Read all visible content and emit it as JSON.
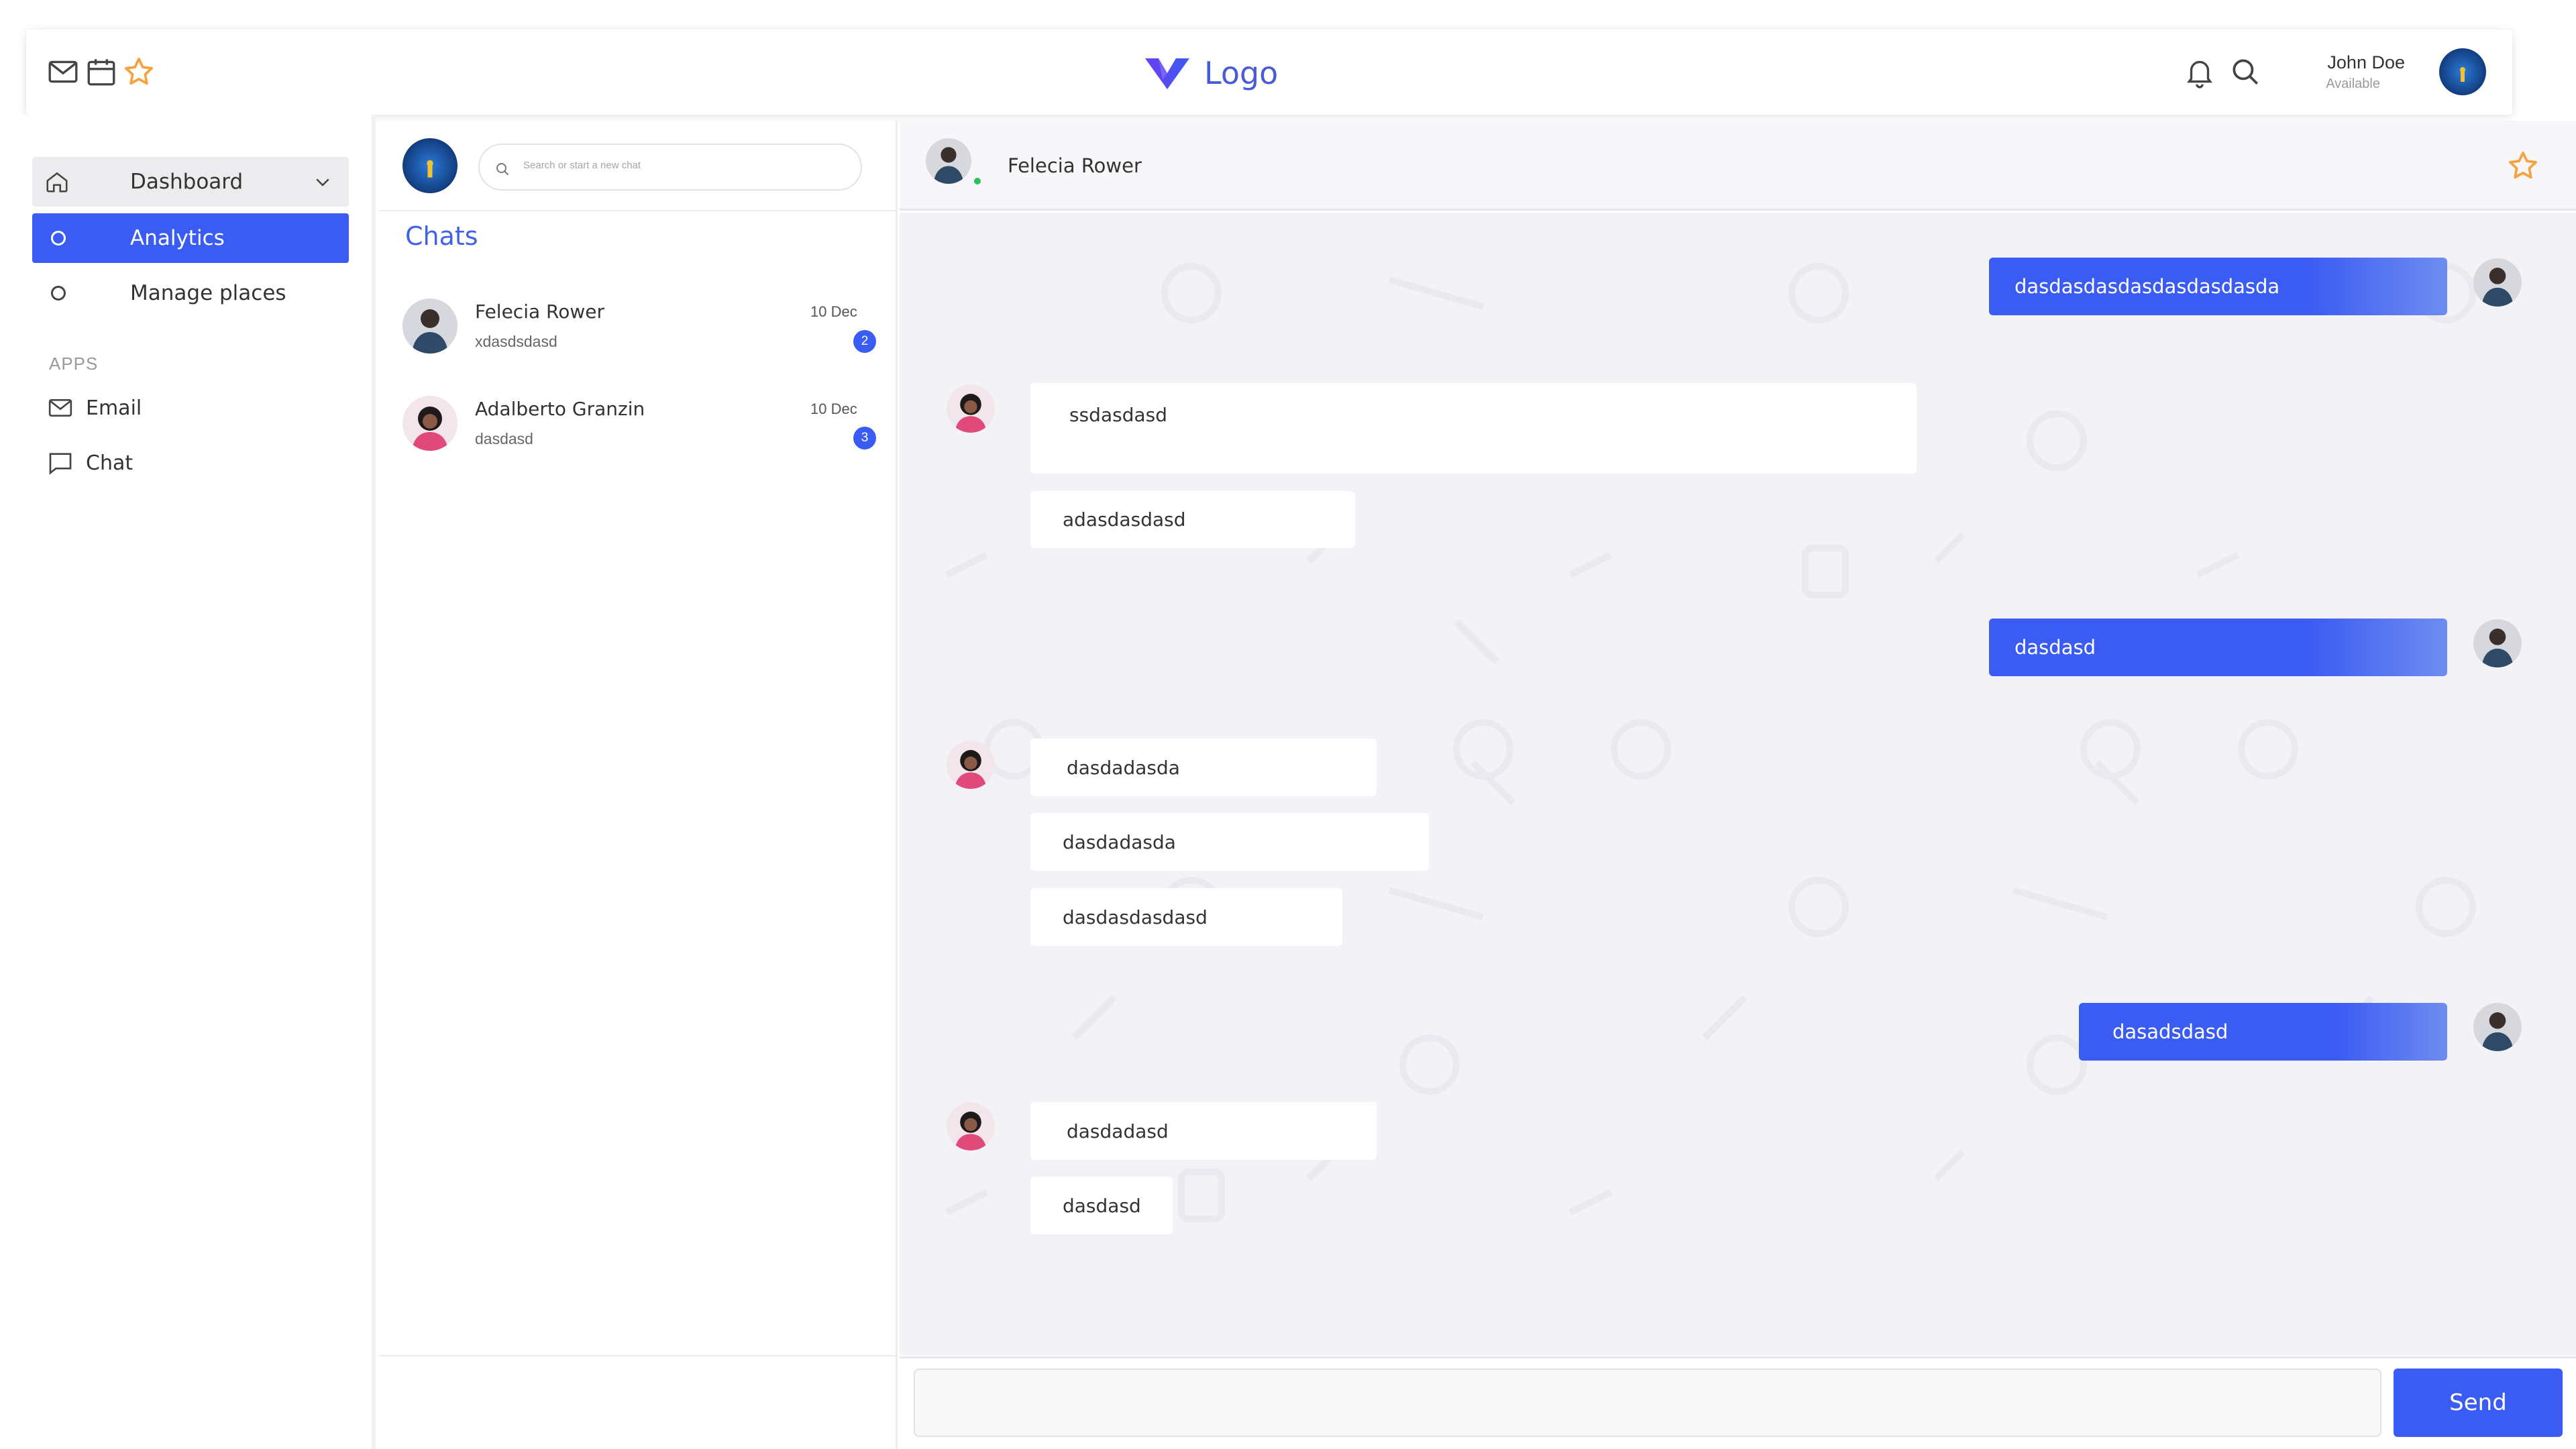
{
  "colors": {
    "accent": "#3b5cf3",
    "star": "#f5a340",
    "online": "#2fbf5a"
  },
  "topbar": {
    "icons": [
      "mail-icon",
      "calendar-icon",
      "star-icon"
    ],
    "logo_text": "Logo",
    "right_icons": [
      "bell-icon",
      "search-icon"
    ],
    "user": {
      "name": "John Doe",
      "status": "Available"
    }
  },
  "sidebar": {
    "dashboard_label": "Dashboard",
    "items": [
      {
        "label": "Analytics",
        "active": true
      },
      {
        "label": "Manage places",
        "active": false
      }
    ],
    "apps_heading": "APPS",
    "apps": [
      {
        "label": "Email",
        "icon": "mail-icon"
      },
      {
        "label": "Chat",
        "icon": "chat-bubble-icon"
      }
    ]
  },
  "chat_list": {
    "search_placeholder": "Search or start a new chat",
    "title": "Chats",
    "chats": [
      {
        "name": "Felecia Rower",
        "preview": "xdasdsdasd",
        "date": "10 Dec",
        "unread": "2"
      },
      {
        "name": "Adalberto Granzin",
        "preview": "dasdasd",
        "date": "10 Dec",
        "unread": "3"
      }
    ]
  },
  "conversation": {
    "contact_name": "Felecia Rower",
    "messages": [
      {
        "from": "me",
        "text": "dasdasdasdasdasdasdasda"
      },
      {
        "from": "them",
        "text": "ssdasdasd"
      },
      {
        "from": "them",
        "text": "adasdasdasd"
      },
      {
        "from": "me",
        "text": "dasdasd"
      },
      {
        "from": "them",
        "text": "dasdadasda"
      },
      {
        "from": "them",
        "text": "dasdadasda"
      },
      {
        "from": "them",
        "text": "dasdasdasdasd"
      },
      {
        "from": "me",
        "text": "dasadsdasd"
      },
      {
        "from": "them",
        "text": "dasdadasd"
      },
      {
        "from": "them",
        "text": "dasdasd"
      }
    ],
    "send_label": "Send"
  }
}
